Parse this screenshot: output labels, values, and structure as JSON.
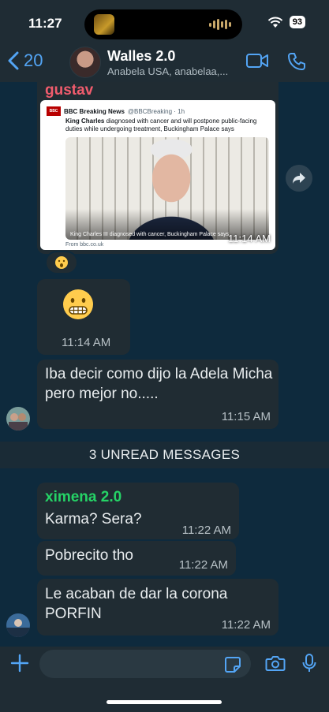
{
  "status_bar": {
    "time": "11:27",
    "battery": "93"
  },
  "header": {
    "back_count": "20",
    "title": "Walles 2.0",
    "subtitle": "Anabela USA, anabelaa,..."
  },
  "messages": {
    "forwarded": {
      "sender": "gustav",
      "sender_color": "#f15c6d",
      "tweet": {
        "account": "BBC Breaking News",
        "handle": "@BBCBreaking · 1h",
        "text_bold": "King Charles",
        "text": "diagnosed with cancer and will postpone public-facing duties while undergoing treatment, Buckingham Palace says",
        "image_caption": "King Charles III diagnosed with cancer, Buckingham Palace says",
        "source": "From bbc.co.uk"
      },
      "time": "11:14 AM",
      "reaction": "😮"
    },
    "emoji_msg": {
      "emoji": "grimacing-face",
      "time": "11:14 AM"
    },
    "text_msg": {
      "text": "Iba decir como dijo la Adela Micha pero mejor no.....",
      "time": "11:15 AM"
    },
    "unread_banner": "3 UNREAD MESSAGES",
    "ximena_1": {
      "sender": "ximena 2.0",
      "sender_color": "#25d366",
      "text": "Karma? Sera?",
      "time": "11:22 AM"
    },
    "ximena_2": {
      "text": "Pobrecito tho",
      "time": "11:22 AM"
    },
    "ximena_3": {
      "text": "Le acaban de dar la corona PORFIN",
      "time": "11:22 AM"
    }
  },
  "colors": {
    "accent": "#53a5f5",
    "bubble": "#202c33",
    "header": "#1f2c34",
    "chat_bg": "#0e2a3d"
  }
}
